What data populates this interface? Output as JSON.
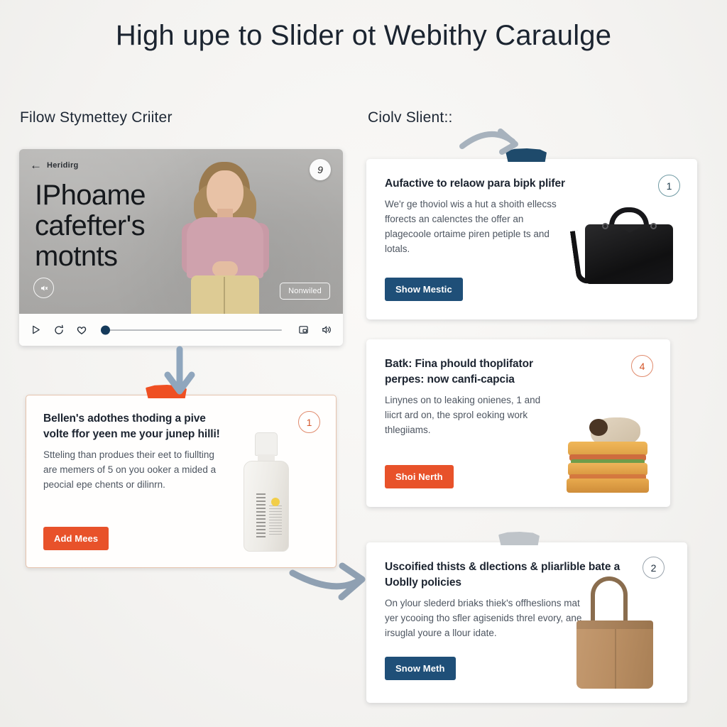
{
  "page": {
    "title": "High upe to Slider ot Webithy Caraulge",
    "background_color": "#f6f5f3"
  },
  "sections": {
    "left_label": "Filow Stymettey Criiter",
    "right_label": "Ciolv Slient::"
  },
  "video_card": {
    "back_label": "Heridirg",
    "back_icon": "arrow-left-icon",
    "headline": "IPhoame cafefter's motnts",
    "badge": "9",
    "mute_icon": "volume-mute-icon",
    "cta_label": "Nonwiled",
    "controls": {
      "play_icon": "play-icon",
      "replay_icon": "replay-icon",
      "like_icon": "heart-icon",
      "pip_icon": "picture-in-picture-icon",
      "volume_icon": "volume-icon",
      "progress_percent": 0,
      "knob_color": "#153a5b"
    }
  },
  "left_card": {
    "title": "Bellen's adothes thoding a pive volte ffor yeen me your junep hilli!",
    "body": "Stteling than produes their eet to fiullting are memers of 5 on you ooker a mided a peocial epe chents or dilinrn.",
    "button_label": "Add Mees",
    "button_color": "#e8522a",
    "badge": "1",
    "border_color": "#e6c3ad",
    "notch_color": "#ef4f22",
    "product_icon": "bottle-product-image"
  },
  "right_cards": [
    {
      "title": "Aufactive to relaow para bipk plifer",
      "body": "We'r ge thoviol wis a hut a shoith ellecss fforects an calenctes the offer an plagecoole ortaime piren petiple ts and lotals.",
      "button_label": "Show Mestic",
      "button_color": "#1f4f78",
      "badge": "1",
      "notch_color": "#1e4a6b",
      "product_icon": "briefcase-bag-image"
    },
    {
      "title": "Batk: Fina phould thoplifator perpes: now canfi-capcia",
      "body": "Linynes on to leaking onienes, 1 and liicrt ard on, the sprol eoking work thlegiiams.",
      "button_label": "Shoi Nerth",
      "button_color": "#e8522a",
      "badge": "4",
      "notch_color": "",
      "product_icon": "sandwich-image"
    },
    {
      "title": "Uscoified thists & dlections & pliarlible bate a Uoblly policies",
      "body": "On ylour slederd briaks thiek's offheslions mat yer ycooing tho sfler agisenids threl evory, ane irsuglal youre a llour idate.",
      "button_label": "Snow Meth",
      "button_color": "#1f4f78",
      "badge": "2",
      "notch_color": "#bfc4c9",
      "product_icon": "tote-bag-image"
    }
  ],
  "arrows": [
    {
      "name": "arrow-video-to-left-card",
      "style": "straight-down",
      "color": "#8fa6bd"
    },
    {
      "name": "arrow-to-right-card-1",
      "style": "curved-right",
      "color": "#a7b2bd"
    },
    {
      "name": "arrow-left-card-to-right-card-3",
      "style": "curved-right",
      "color": "#8fa0b2"
    }
  ]
}
